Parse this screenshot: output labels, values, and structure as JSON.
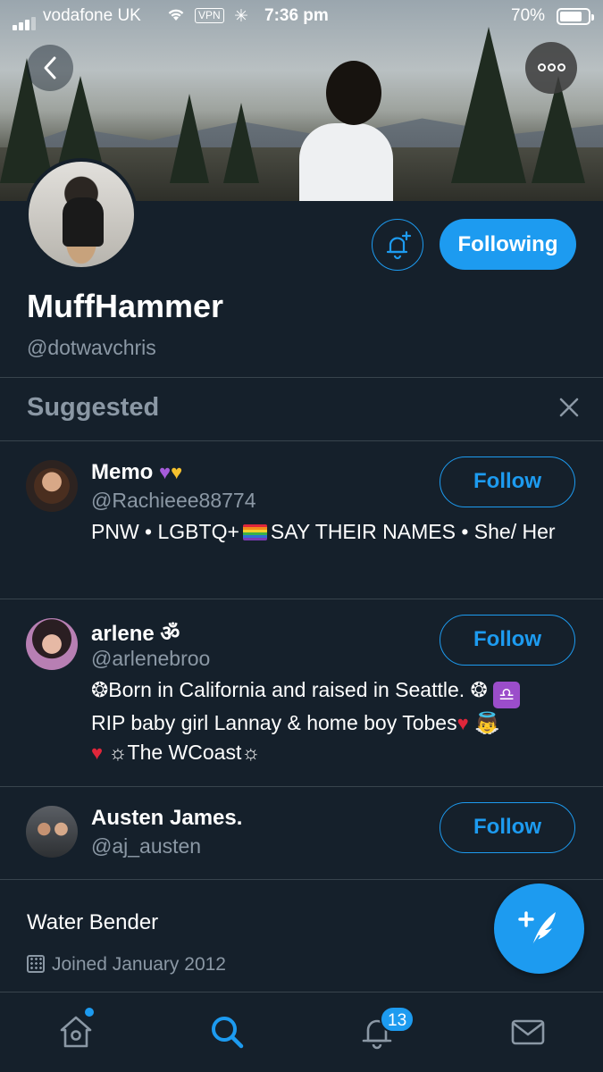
{
  "status_bar": {
    "carrier": "vodafone UK",
    "vpn": "VPN",
    "time": "7:36 pm",
    "battery": "70%",
    "battery_level": 0.7
  },
  "profile": {
    "display_name": "MuffHammer",
    "handle": "@dotwavchris",
    "following_label": "Following",
    "bio": "Water Bender",
    "joined": "Joined January 2012"
  },
  "suggested": {
    "title": "Suggested",
    "follow_label": "Follow",
    "users": [
      {
        "name": "Memo",
        "handle": "@Rachieee88774",
        "bio_pre": "PNW • LGBTQ+",
        "bio_post": "SAY THEIR NAMES • She/ Her"
      },
      {
        "name": "arlene ॐ",
        "handle": "@arlenebroo",
        "bio_line1": "❂Born in California and raised in Seattle. ❂",
        "bio_line2": "RIP baby girl Lannay & home boy Tobes",
        "bio_line3": "☼The WCoast☼"
      },
      {
        "name": "Austen James.",
        "handle": "@aj_austen"
      }
    ]
  },
  "tab_bar": {
    "notifications_badge": "13"
  },
  "icons": {
    "back": "chevron-left-icon",
    "more": "more-options-icon",
    "bell": "bell-plus-icon",
    "close": "close-icon",
    "compose": "compose-tweet-icon",
    "tabs": [
      "home-icon",
      "search-icon",
      "bell-icon",
      "mail-icon"
    ]
  },
  "colors": {
    "background": "#15202b",
    "accent": "#1d9bf0",
    "secondary_text": "#8b98a5",
    "divider": "#38444d"
  }
}
